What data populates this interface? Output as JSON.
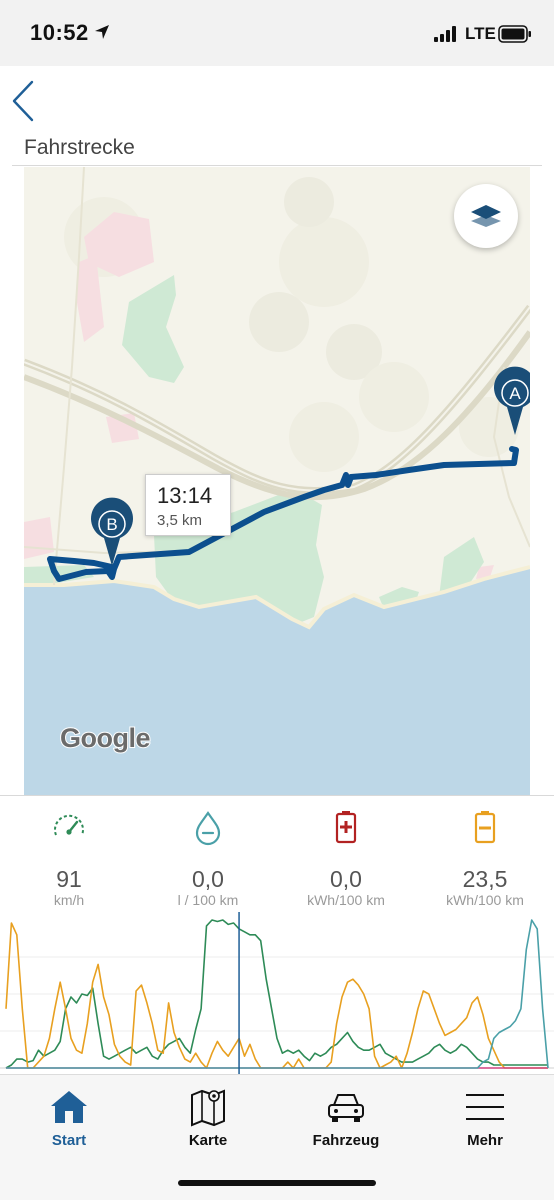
{
  "status_bar": {
    "time": "10:52",
    "network": "LTE"
  },
  "header": {
    "title": "Fahrstrecke"
  },
  "map": {
    "tooltip": {
      "time": "13:14",
      "distance": "3,5 km"
    },
    "start_marker_label": "A",
    "end_marker_label": "B",
    "attribution": "Google",
    "route_color": "#0c4f8e",
    "water_color": "#bdd7e7",
    "land_color": "#f4f3ea",
    "park_color": "#cfe9d4"
  },
  "metrics": [
    {
      "value": "91",
      "unit": "km/h",
      "icon": "speedometer-icon",
      "color": "#2e8b57"
    },
    {
      "value": "0,0",
      "unit": "l / 100 km",
      "icon": "fuel-drop-icon",
      "color": "#4aa0a8"
    },
    {
      "value": "0,0",
      "unit": "kWh/100 km",
      "icon": "battery-charge-icon",
      "color": "#b22222"
    },
    {
      "value": "23,5",
      "unit": "kWh/100 km",
      "icon": "battery-discharge-icon",
      "color": "#e8a020"
    }
  ],
  "chart_data": {
    "type": "line",
    "x": [
      0,
      1,
      2,
      3,
      4,
      5,
      6,
      7,
      8,
      9,
      10,
      11,
      12,
      13,
      14,
      15,
      16,
      17,
      18,
      19,
      20,
      21,
      22,
      23,
      24,
      25,
      26,
      27,
      28,
      29,
      30,
      31,
      32,
      33,
      34,
      35,
      36,
      37,
      38,
      39,
      40,
      41,
      42,
      43,
      44,
      45,
      46,
      47,
      48,
      49,
      50,
      51,
      52,
      53,
      54,
      55,
      56,
      57,
      58,
      59,
      60,
      61,
      62,
      63,
      64,
      65,
      66,
      67,
      68,
      69,
      70,
      71,
      72,
      73,
      74,
      75,
      76,
      77,
      78,
      79,
      80,
      81,
      82,
      83,
      84,
      85,
      86,
      87,
      88,
      89,
      90,
      91,
      92,
      93,
      94,
      95,
      96,
      97,
      98,
      99,
      100
    ],
    "series": [
      {
        "color": "#2e8b57",
        "values": [
          0,
          2,
          6,
          6,
          4,
          5,
          12,
          8,
          10,
          12,
          18,
          40,
          48,
          44,
          50,
          49,
          54,
          30,
          8,
          6,
          8,
          10,
          12,
          14,
          10,
          12,
          14,
          8,
          6,
          12,
          16,
          18,
          20,
          14,
          10,
          26,
          40,
          96,
          100,
          99,
          100,
          97,
          98,
          94,
          92,
          90,
          90,
          86,
          60,
          40,
          20,
          10,
          12,
          10,
          12,
          8,
          5,
          10,
          8,
          10,
          14,
          16,
          20,
          24,
          18,
          14,
          12,
          12,
          14,
          16,
          10,
          8,
          6,
          4,
          4,
          4,
          6,
          8,
          10,
          14,
          16,
          12,
          10,
          12,
          16,
          14,
          10,
          6,
          4,
          4,
          2,
          2,
          2,
          2,
          2,
          2,
          2,
          2,
          2,
          2,
          2
        ]
      },
      {
        "color": "#e8a020",
        "values": [
          40,
          98,
          90,
          40,
          0,
          0,
          4,
          8,
          20,
          40,
          58,
          40,
          20,
          12,
          10,
          30,
          58,
          70,
          48,
          36,
          16,
          8,
          4,
          2,
          52,
          56,
          44,
          30,
          12,
          10,
          44,
          24,
          14,
          6,
          4,
          10,
          4,
          0,
          10,
          18,
          12,
          8,
          14,
          20,
          8,
          16,
          6,
          0,
          0,
          0,
          0,
          0,
          4,
          0,
          6,
          0,
          0,
          0,
          0,
          0,
          4,
          30,
          48,
          58,
          60,
          56,
          50,
          40,
          8,
          0,
          2,
          4,
          8,
          0,
          10,
          24,
          40,
          52,
          50,
          40,
          30,
          22,
          24,
          26,
          30,
          34,
          44,
          48,
          36,
          20,
          12,
          4,
          0,
          0,
          0,
          0,
          0,
          0,
          0,
          0,
          0
        ]
      },
      {
        "color": "#d04080",
        "values": [
          0,
          0,
          0,
          0,
          0,
          0,
          0,
          0,
          0,
          0,
          0,
          0,
          0,
          0,
          0,
          0,
          0,
          0,
          0,
          0,
          0,
          0,
          0,
          0,
          0,
          0,
          0,
          0,
          0,
          0,
          0,
          0,
          0,
          0,
          0,
          0,
          0,
          0,
          0,
          0,
          0,
          0,
          0,
          0,
          0,
          0,
          0,
          0,
          0,
          0,
          0,
          0,
          0,
          0,
          0,
          0,
          0,
          0,
          0,
          0,
          0,
          0,
          0,
          0,
          0,
          0,
          0,
          0,
          0,
          0,
          0,
          0,
          0,
          0,
          0,
          0,
          0,
          0,
          0,
          0,
          0,
          0,
          0,
          0,
          0,
          0,
          0,
          0,
          0,
          0,
          0,
          0,
          0,
          0,
          0,
          0,
          0,
          0,
          0,
          0,
          0
        ]
      },
      {
        "color": "#4aa0a8",
        "values": [
          0,
          0,
          0,
          0,
          0,
          0,
          0,
          0,
          0,
          0,
          0,
          0,
          0,
          0,
          0,
          0,
          0,
          0,
          0,
          0,
          0,
          0,
          0,
          0,
          0,
          0,
          0,
          0,
          0,
          0,
          0,
          0,
          0,
          0,
          0,
          0,
          0,
          0,
          0,
          0,
          0,
          0,
          0,
          0,
          0,
          0,
          0,
          0,
          0,
          0,
          0,
          0,
          0,
          0,
          0,
          0,
          0,
          0,
          0,
          0,
          0,
          0,
          0,
          0,
          0,
          0,
          0,
          0,
          0,
          0,
          0,
          0,
          0,
          0,
          0,
          0,
          0,
          0,
          0,
          0,
          0,
          0,
          0,
          0,
          0,
          0,
          0,
          0,
          4,
          6,
          20,
          24,
          26,
          28,
          32,
          40,
          80,
          100,
          94,
          40,
          0
        ]
      }
    ],
    "ylim": [
      0,
      100
    ],
    "cursor_x": 43,
    "cursor_color": "#1f5f97"
  },
  "tabs": [
    {
      "label": "Start",
      "icon": "home-icon",
      "active": true
    },
    {
      "label": "Karte",
      "icon": "map-icon",
      "active": false
    },
    {
      "label": "Fahrzeug",
      "icon": "car-icon",
      "active": false
    },
    {
      "label": "Mehr",
      "icon": "menu-icon",
      "active": false
    }
  ]
}
